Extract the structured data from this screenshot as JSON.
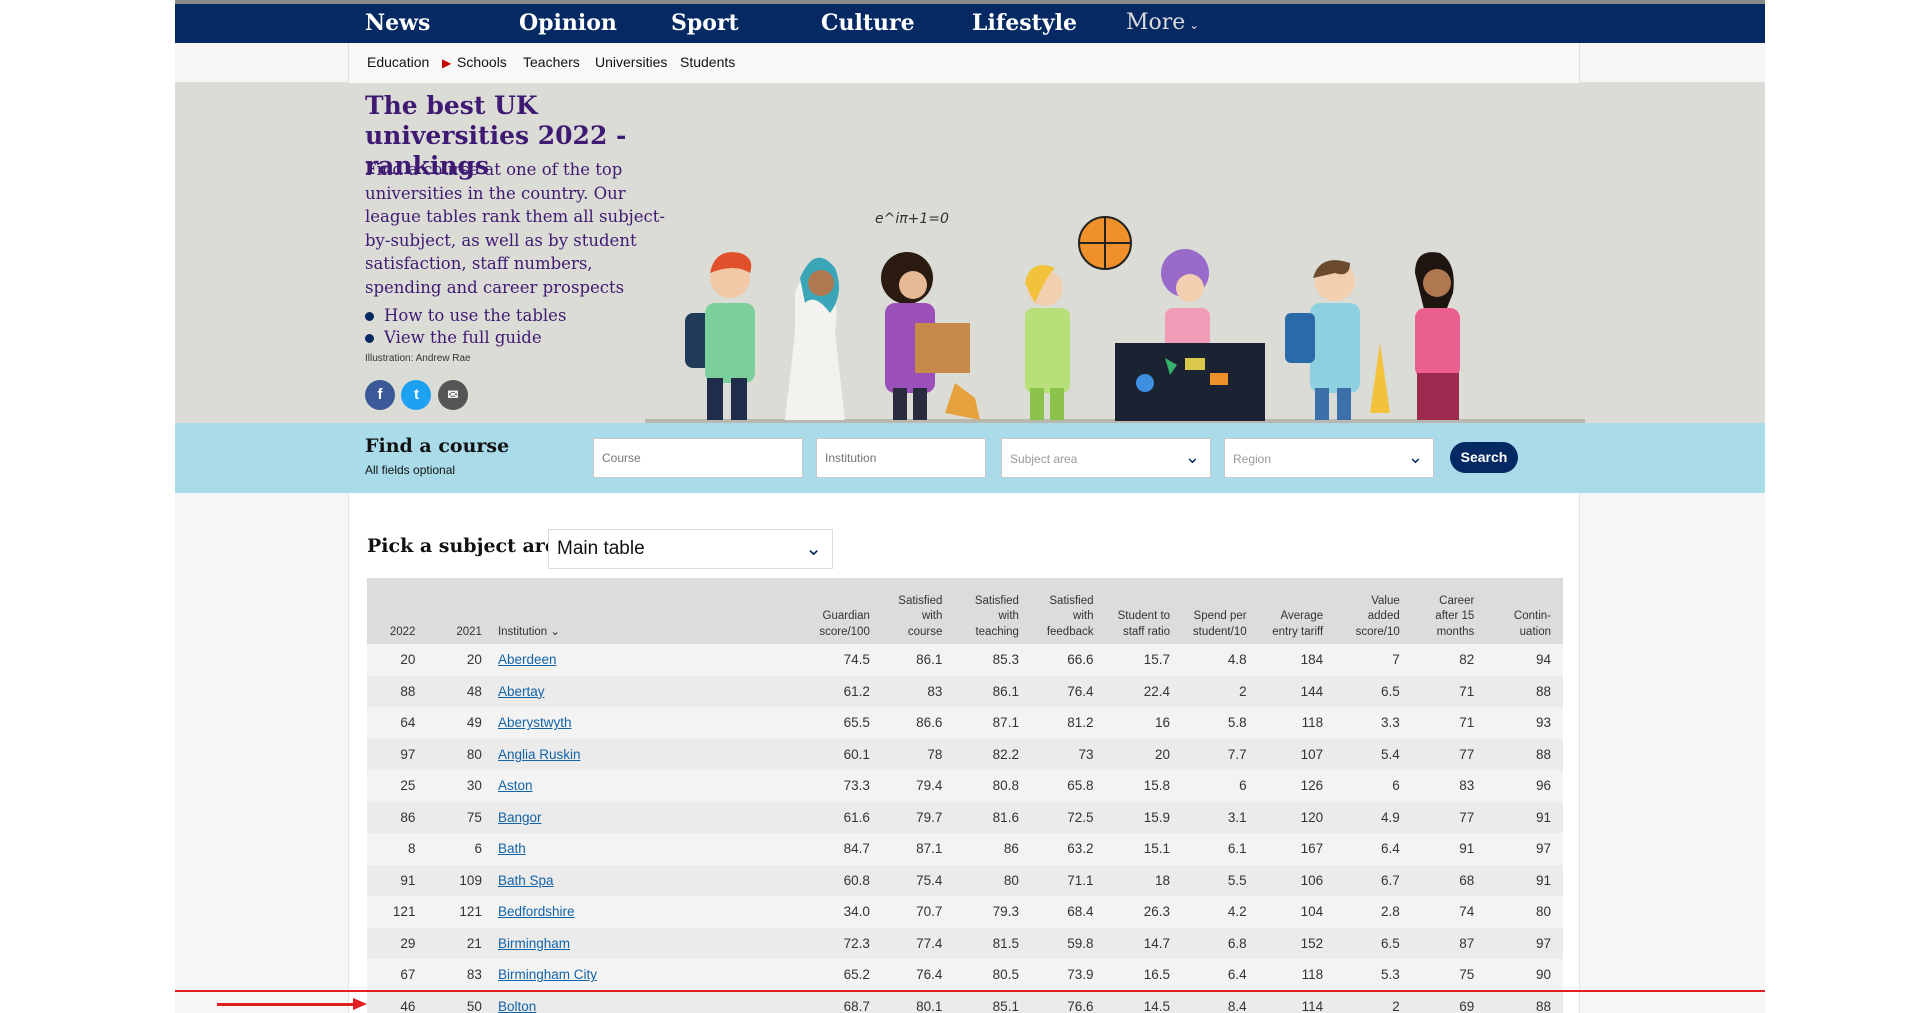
{
  "nav": {
    "items": [
      "News",
      "Opinion",
      "Sport",
      "Culture",
      "Lifestyle"
    ],
    "more": "More"
  },
  "subnav": {
    "section": "Education",
    "items": [
      "Schools",
      "Teachers",
      "Universities",
      "Students"
    ]
  },
  "hero": {
    "title": "The best UK universities 2022 - rankings",
    "intro": "Find a course at one of the top universities in the country. Our league tables rank them all subject-by-subject, as well as by student satisfaction, staff numbers, spending and career prospects",
    "links": [
      "How to use the tables",
      "View the full guide"
    ],
    "credit": "Illustration: Andrew Rae",
    "illustration_text": "e^iπ+1=0"
  },
  "find": {
    "title": "Find a course",
    "subtitle": "All fields optional",
    "course_placeholder": "Course",
    "institution_placeholder": "Institution",
    "subject_area": "Subject area",
    "region": "Region",
    "search": "Search"
  },
  "pick": {
    "label": "Pick a subject area",
    "selected": "Main table"
  },
  "table": {
    "headers": [
      "2022",
      "2021",
      "Institution",
      "Guardian score/100",
      "Satisfied with course",
      "Satisfied with teaching",
      "Satisfied with feedback",
      "Student to staff ratio",
      "Spend per student/10",
      "Average entry tariff",
      "Value added score/10",
      "Career after 15 months",
      "Contin-uation"
    ],
    "rows": [
      [
        "20",
        "20",
        "Aberdeen",
        "74.5",
        "86.1",
        "85.3",
        "66.6",
        "15.7",
        "4.8",
        "184",
        "7",
        "82",
        "94"
      ],
      [
        "88",
        "48",
        "Abertay",
        "61.2",
        "83",
        "86.1",
        "76.4",
        "22.4",
        "2",
        "144",
        "6.5",
        "71",
        "88"
      ],
      [
        "64",
        "49",
        "Aberystwyth",
        "65.5",
        "86.6",
        "87.1",
        "81.2",
        "16",
        "5.8",
        "118",
        "3.3",
        "71",
        "93"
      ],
      [
        "97",
        "80",
        "Anglia Ruskin",
        "60.1",
        "78",
        "82.2",
        "73",
        "20",
        "7.7",
        "107",
        "5.4",
        "77",
        "88"
      ],
      [
        "25",
        "30",
        "Aston",
        "73.3",
        "79.4",
        "80.8",
        "65.8",
        "15.8",
        "6",
        "126",
        "6",
        "83",
        "96"
      ],
      [
        "86",
        "75",
        "Bangor",
        "61.6",
        "79.7",
        "81.6",
        "72.5",
        "15.9",
        "3.1",
        "120",
        "4.9",
        "77",
        "91"
      ],
      [
        "8",
        "6",
        "Bath",
        "84.7",
        "87.1",
        "86",
        "63.2",
        "15.1",
        "6.1",
        "167",
        "6.4",
        "91",
        "97"
      ],
      [
        "91",
        "109",
        "Bath Spa",
        "60.8",
        "75.4",
        "80",
        "71.1",
        "18",
        "5.5",
        "106",
        "6.7",
        "68",
        "91"
      ],
      [
        "121",
        "121",
        "Bedfordshire",
        "34.0",
        "70.7",
        "79.3",
        "68.4",
        "26.3",
        "4.2",
        "104",
        "2.8",
        "74",
        "80"
      ],
      [
        "29",
        "21",
        "Birmingham",
        "72.3",
        "77.4",
        "81.5",
        "59.8",
        "14.7",
        "6.8",
        "152",
        "6.5",
        "87",
        "97"
      ],
      [
        "67",
        "83",
        "Birmingham City",
        "65.2",
        "76.4",
        "80.5",
        "73.9",
        "16.5",
        "6.4",
        "118",
        "5.3",
        "75",
        "90"
      ],
      [
        "46",
        "50",
        "Bolton",
        "68.7",
        "80.1",
        "85.1",
        "76.6",
        "14.5",
        "8.4",
        "114",
        "2",
        "69",
        "88"
      ]
    ]
  },
  "colors": {
    "nav_bg": "#052962",
    "hero_text": "#3f1a73",
    "find_bar": "#a9dbe9",
    "link": "#1463a7",
    "highlight": "#e02020"
  }
}
